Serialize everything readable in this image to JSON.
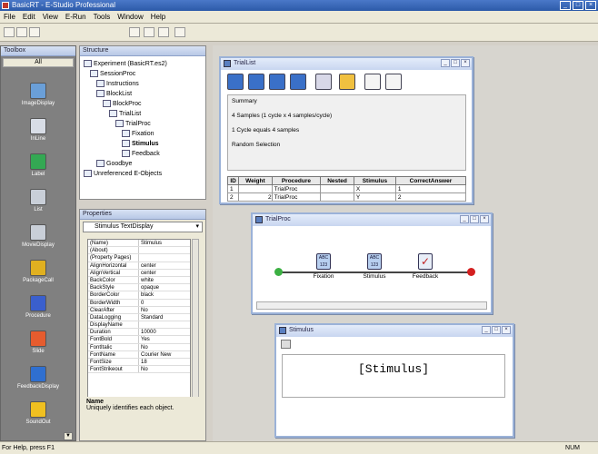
{
  "window": {
    "title": "BasicRT - E-Studio Professional",
    "controls": [
      "_",
      "□",
      "×"
    ]
  },
  "menu": [
    "File",
    "Edit",
    "View",
    "E-Run",
    "Tools",
    "Window",
    "Help"
  ],
  "toolbox": {
    "title": "Toolbox",
    "all_label": "All",
    "items": [
      {
        "label": "ImageDisplay",
        "color": "#6a9fd8"
      },
      {
        "label": "InLine",
        "color": "#d8dde6"
      },
      {
        "label": "Label",
        "color": "#34a853"
      },
      {
        "label": "List",
        "color": "#c9cfd8"
      },
      {
        "label": "MovieDisplay",
        "color": "#c9cfd8"
      },
      {
        "label": "PackageCall",
        "color": "#e0b020"
      },
      {
        "label": "Procedure",
        "color": "#3a5fcd"
      },
      {
        "label": "Slide",
        "color": "#e65c2e"
      },
      {
        "label": "FeedbackDisplay",
        "color": "#2f6fd0"
      },
      {
        "label": "SoundOut",
        "color": "#f0c020"
      }
    ]
  },
  "structure": {
    "title": "Structure",
    "tree": [
      {
        "label": "Experiment (BasicRT.es2)",
        "depth": 0
      },
      {
        "label": "SessionProc",
        "depth": 1
      },
      {
        "label": "Instructions",
        "depth": 2
      },
      {
        "label": "BlockList",
        "depth": 2
      },
      {
        "label": "BlockProc",
        "depth": 3
      },
      {
        "label": "TrialList",
        "depth": 4
      },
      {
        "label": "TrialProc",
        "depth": 5
      },
      {
        "label": "Fixation",
        "depth": 6
      },
      {
        "label": "Stimulus",
        "depth": 6,
        "bold": true
      },
      {
        "label": "Feedback",
        "depth": 6
      },
      {
        "label": "Goodbye",
        "depth": 2
      },
      {
        "label": "Unreferenced E-Objects",
        "depth": 0
      }
    ]
  },
  "properties": {
    "title": "Properties",
    "selected_object": "Stimulus TextDisplay",
    "rows": [
      [
        "(Name)",
        "Stimulus"
      ],
      [
        "(About)",
        ""
      ],
      [
        "(Property Pages)",
        ""
      ],
      [
        "AlignHorizontal",
        "center"
      ],
      [
        "AlignVertical",
        "center"
      ],
      [
        "BackColor",
        "white"
      ],
      [
        "BackStyle",
        "opaque"
      ],
      [
        "BorderColor",
        "black"
      ],
      [
        "BorderWidth",
        "0"
      ],
      [
        "ClearAfter",
        "No"
      ],
      [
        "DataLogging",
        "Standard"
      ],
      [
        "DisplayName",
        ""
      ],
      [
        "Duration",
        "10000"
      ],
      [
        "FontBold",
        "Yes"
      ],
      [
        "FontItalic",
        "No"
      ],
      [
        "FontName",
        "Courier New"
      ],
      [
        "FontSize",
        "18"
      ],
      [
        "FontStrikeout",
        "No"
      ]
    ],
    "description_title": "Name",
    "description_text": "Uniquely identifies each object."
  },
  "triallist": {
    "title": "TrialList",
    "summary_title": "Summary",
    "summary_lines": [
      "4 Samples (1 cycle x 4 samples/cycle)",
      "1 Cycle equals 4 samples",
      "Random Selection"
    ],
    "columns": [
      "ID",
      "Weight",
      "Procedure",
      "Nested",
      "Stimulus",
      "CorrectAnswer"
    ],
    "rows": [
      [
        "1",
        "",
        "TrialProc",
        "",
        "X",
        "1"
      ],
      [
        "2",
        "2",
        "TrialProc",
        "",
        "Y",
        "2"
      ]
    ]
  },
  "trialproc": {
    "title": "TrialProc",
    "nodes": [
      "Fixation",
      "Stimulus",
      "Feedback"
    ]
  },
  "stimulus_win": {
    "title": "Stimulus",
    "text": "[Stimulus]"
  },
  "status": {
    "left": "For Help, press F1",
    "right": "NUM"
  },
  "colors": {
    "titlebar": "#2c5aa8",
    "workspace": "#d7d5cf",
    "start": "#3cb043",
    "end": "#d42020"
  }
}
